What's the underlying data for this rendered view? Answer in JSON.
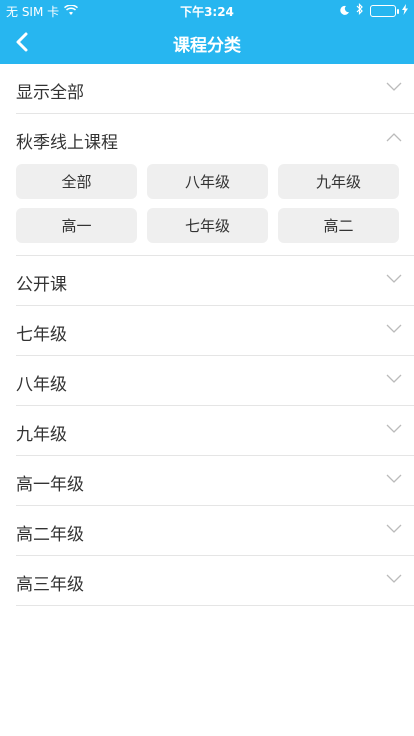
{
  "status_bar": {
    "carrier": "无 SIM 卡",
    "time": "下午3:24"
  },
  "nav": {
    "title": "课程分类"
  },
  "categories": [
    {
      "label": "显示全部"
    },
    {
      "label": "秋季线上课程",
      "expanded": true,
      "options": [
        "全部",
        "八年级",
        "九年级",
        "高一",
        "七年级",
        "高二"
      ]
    },
    {
      "label": "公开课"
    },
    {
      "label": "七年级"
    },
    {
      "label": "八年级"
    },
    {
      "label": "九年级"
    },
    {
      "label": "高一年级"
    },
    {
      "label": "高二年级"
    },
    {
      "label": "高三年级"
    }
  ],
  "colors": {
    "header_bg": "#27b6f0",
    "chip_bg": "#efefef",
    "battery": "#4cd964"
  }
}
